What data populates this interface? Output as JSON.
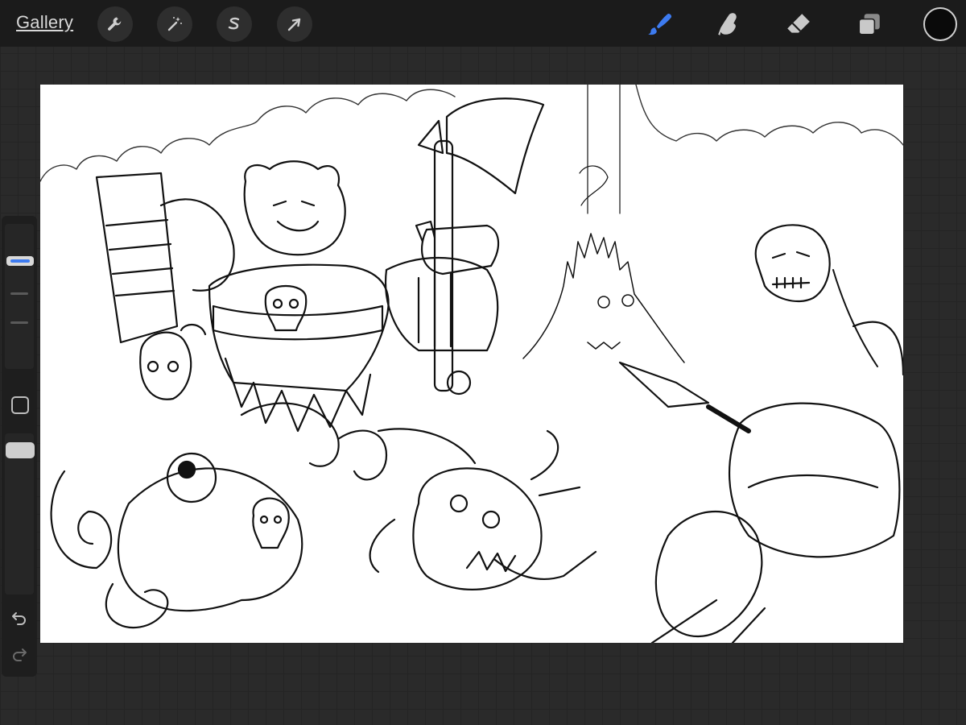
{
  "toolbar": {
    "gallery_label": "Gallery",
    "left_tools": [
      {
        "name": "actions",
        "icon": "wrench-icon"
      },
      {
        "name": "adjustments",
        "icon": "magic-wand-icon"
      },
      {
        "name": "selection",
        "icon": "selection-s-icon"
      },
      {
        "name": "transform",
        "icon": "arrow-cursor-icon"
      }
    ],
    "right_tools": [
      {
        "name": "brush",
        "icon": "brush-icon",
        "active": true
      },
      {
        "name": "smudge",
        "icon": "smudge-finger-icon",
        "active": false
      },
      {
        "name": "eraser",
        "icon": "eraser-icon",
        "active": false
      },
      {
        "name": "layers",
        "icon": "layers-icon",
        "active": false
      }
    ],
    "current_color": "#0a0a0a",
    "accent": "#3d7bf0"
  },
  "sidebar": {
    "brush_size_level": "low",
    "opacity_level": "high",
    "buttons": [
      "modify-button",
      "undo-icon",
      "redo-icon"
    ]
  },
  "canvas": {
    "background": "#ffffff",
    "content": "black-line-art-illustration"
  }
}
